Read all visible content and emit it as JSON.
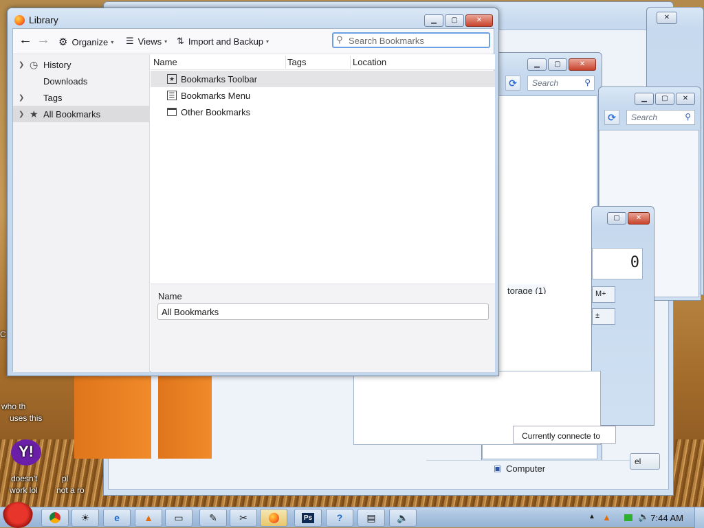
{
  "library": {
    "title": "Library",
    "toolbar": {
      "organize": "Organize",
      "views": "Views",
      "import_backup": "Import and Backup",
      "search_placeholder": "Search Bookmarks"
    },
    "sidebar": [
      {
        "label": "History",
        "icon": "clock-icon",
        "expandable": true,
        "selected": false
      },
      {
        "label": "Downloads",
        "icon": "download-icon",
        "expandable": false,
        "selected": false
      },
      {
        "label": "Tags",
        "icon": "tag-icon",
        "expandable": true,
        "selected": false
      },
      {
        "label": "All Bookmarks",
        "icon": "star-icon",
        "expandable": true,
        "selected": true
      }
    ],
    "columns": {
      "name": "Name",
      "tags": "Tags",
      "location": "Location"
    },
    "rows": [
      {
        "label": "Bookmarks Toolbar",
        "icon": "bookmarks-toolbar-icon",
        "selected": true
      },
      {
        "label": "Bookmarks Menu",
        "icon": "bookmarks-menu-icon",
        "selected": false
      },
      {
        "label": "Other Bookmarks",
        "icon": "folder-icon",
        "selected": false
      }
    ],
    "details": {
      "name_label": "Name",
      "name_value": "All Bookmarks"
    }
  },
  "background": {
    "search_a": "Search",
    "search_b": "Search",
    "calc_display": "0",
    "storage_text": "torage (1)",
    "connected_text": "Currently connecte  to",
    "computer_label": "Computer",
    "cancel_fragment": "el",
    "mem_plus": "M+",
    "plus_minus": "±"
  },
  "desktop": {
    "icon_texts": [
      "who th",
      "uses this",
      "doesn't",
      "work lol",
      "not a ro",
      "pl",
      "C"
    ]
  },
  "taskbar": {
    "clock": "7:44 AM",
    "buttons": [
      "chrome-icon",
      "weather-icon",
      "ie-icon",
      "vlc-icon",
      "file-icon",
      "notepad-icon",
      "tool-icon",
      "firefox-icon",
      "photoshop-icon",
      "help-icon",
      "network-icon",
      "speaker-icon"
    ]
  },
  "colors": {
    "accent": "#6aa0e4",
    "selection": "#dcdcde",
    "taskbar": "#a8c2df"
  }
}
